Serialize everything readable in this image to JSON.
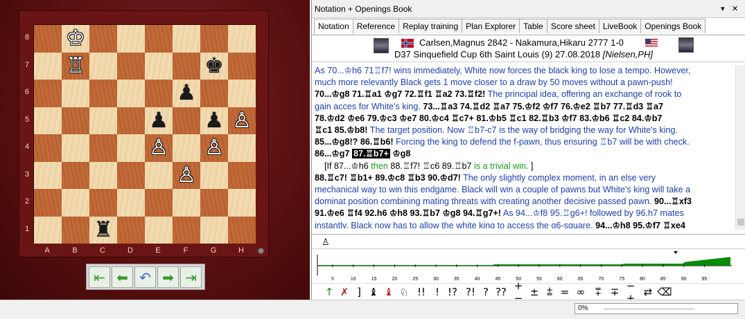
{
  "board": {
    "files": [
      "A",
      "B",
      "C",
      "D",
      "E",
      "F",
      "G",
      "H"
    ],
    "ranks": [
      "8",
      "7",
      "6",
      "5",
      "4",
      "3",
      "2",
      "1"
    ],
    "pieces": {
      "b8": {
        "glyph": "♔",
        "color": "w"
      },
      "b7": {
        "glyph": "♖",
        "color": "w"
      },
      "g7": {
        "glyph": "♚",
        "color": "b"
      },
      "f6": {
        "glyph": "♟",
        "color": "b"
      },
      "e5": {
        "glyph": "♟",
        "color": "b"
      },
      "g5": {
        "glyph": "♟",
        "color": "b"
      },
      "h5": {
        "glyph": "♙",
        "color": "w"
      },
      "e4": {
        "glyph": "♙",
        "color": "w"
      },
      "g4": {
        "glyph": "♙",
        "color": "w"
      },
      "f3": {
        "glyph": "♙",
        "color": "w"
      },
      "c1": {
        "glyph": "♜",
        "color": "b"
      }
    },
    "nav_buttons": [
      {
        "name": "first-move-icon",
        "glyph": "⇤"
      },
      {
        "name": "back-arrow-icon",
        "glyph": "⬅"
      },
      {
        "name": "undo-icon",
        "glyph": "↶"
      },
      {
        "name": "forward-arrow-icon",
        "glyph": "➡"
      },
      {
        "name": "last-move-icon",
        "glyph": "⇥"
      }
    ]
  },
  "window": {
    "title": "Notation + Openings Book",
    "dropdown_icon": "▾",
    "close_icon": "✕"
  },
  "tabs": [
    "Notation",
    "Reference",
    "Replay training",
    "Plan Explorer",
    "Table",
    "Score sheet",
    "LiveBook",
    "Openings Book"
  ],
  "game_header": {
    "white": "Carlsen,Magnus",
    "white_elo": "2842",
    "separator": "-",
    "black": "Nakamura,Hikaru",
    "black_elo": "2777",
    "result": "1-0",
    "eco": "D37",
    "event": "Sinquefield Cup 6th Saint Louis (9) 27.08.2018",
    "annotator": "[Nielsen,PH]"
  },
  "notation": {
    "line1": "As 70...♔h6 71♖f7! wins immediately, White now forces the black king to lose a tempo. However,",
    "line2": "much more relevantly Black gets 1 move closer to a draw by 50 moves without a pawn-push!",
    "line3_moves": "70...♔g8 71.♖a1 ♔g7 72.♖f1 ♖a2 73.♖f2!",
    "line3_comment": " The principal idea, offering an exchange of rook to",
    "line4_comment": "gain acces for White's king. ",
    "line4_moves": "73...♖a3 74.♖d2 ♖a7 75.♔f2 ♔f7 76.♔e2 ♖b7 77.♖d3 ♖a7",
    "line5_moves": "78.♔d2 ♔e6 79.♔c3 ♔e7 80.♔c4 ♖c7+ 81.♔b5 ♖c1 82.♖b3 ♔f7 83.♔b6 ♖c2 84.♔b7",
    "line6_moves": "♖c1 85.♔b8!",
    "line6_comment": " The target position. Now ♖b7-c7 is the way of bridging the way for White's king.",
    "line7_moves": "85...♔g8!? 86.♖b6!",
    "line7_comment": " Forcing the king to defend the f-pawn, thus ensuring ♖b7 will be with check.",
    "line8_pre": "86...♔g7 ",
    "line8_current": "87.♖b7+",
    "line8_post": " ♔g8",
    "var_open": "[If ",
    "var_move1": "87...♔h6",
    "var_then": " then ",
    "var_move2": "88.♖f7! ♖c6 89.♖b7",
    "var_end": " is a trivial win.",
    "var_close": " ]",
    "line10_moves": "88.♖c7! ♖b1+ 89.♔c8 ♖b3 90.♔d7!",
    "line10_comment": " The only slightly complex moment, in an else very",
    "line11": "mechanical way to win this endgame. Black will win a couple of pawns but White's king will take a",
    "line12_comment": "dominat position combining mating threats with creating another decisive passed pawn. ",
    "line12_moves": "90...♖xf3",
    "line13_moves": "91.♔e6 ♖f4 92.h6 ♔h8 93.♖b7 ♔g8 94.♖g7+!",
    "line13_comment": " As 94...♔f8 95.♖g6+! followed by 96.h7 mates",
    "line14_comment": "instantly. Black now has to allow the white king to access the g6-square. ",
    "line14_moves": "94...♔h8 95.♔f7 ♖xe4"
  },
  "eval_bar": {
    "pawn_icon": "♙"
  },
  "graph": {
    "ticks": [
      "5",
      "10",
      "15",
      "20",
      "25",
      "30",
      "35",
      "40",
      "45",
      "50",
      "55",
      "60",
      "65",
      "70",
      "75",
      "80",
      "85",
      "90",
      "95"
    ],
    "green": "#0a8a0a"
  },
  "symbols": [
    "↑",
    "✗",
    "]",
    "♝",
    "♝",
    "♘",
    "!!",
    "!",
    "!?",
    "?!",
    "?",
    "??",
    "+−",
    "±",
    "⩲",
    "=",
    "∞",
    "⩱",
    "∓",
    "−+",
    "⇄",
    "⌫"
  ],
  "status": {
    "progress": "0%"
  }
}
